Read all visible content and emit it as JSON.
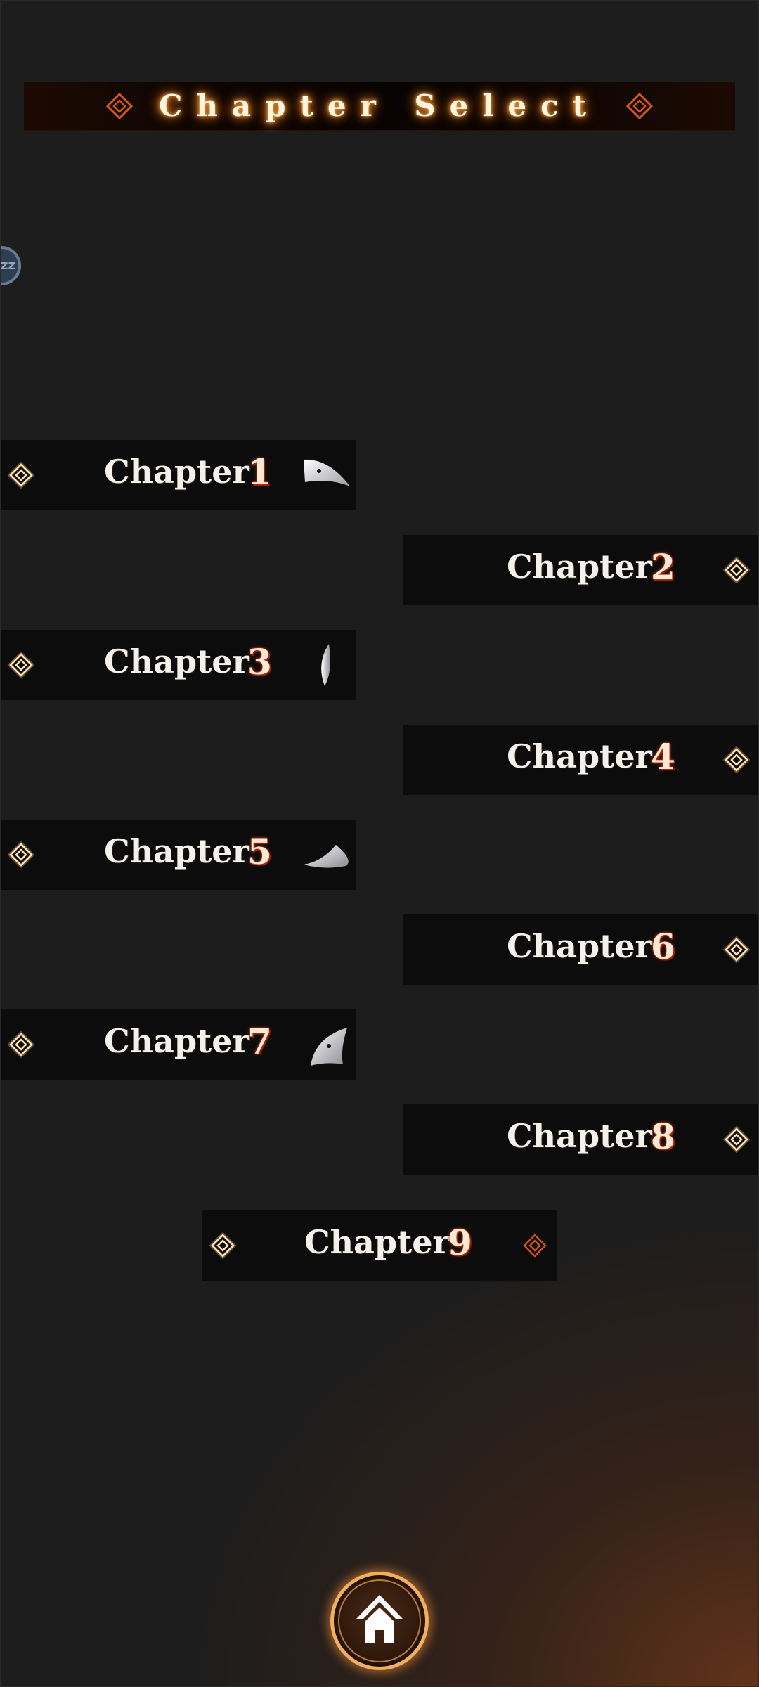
{
  "header": {
    "title": "Chapter Select"
  },
  "side_bubble": {
    "label": "zz"
  },
  "chapters": [
    {
      "word": "Chapter",
      "number": "1",
      "side": "left",
      "piece": "fragment-1"
    },
    {
      "word": "Chapter",
      "number": "2",
      "side": "right",
      "piece": null
    },
    {
      "word": "Chapter",
      "number": "3",
      "side": "left",
      "piece": "fragment-3"
    },
    {
      "word": "Chapter",
      "number": "4",
      "side": "right",
      "piece": null
    },
    {
      "word": "Chapter",
      "number": "5",
      "side": "left",
      "piece": "fragment-5"
    },
    {
      "word": "Chapter",
      "number": "6",
      "side": "right",
      "piece": null
    },
    {
      "word": "Chapter",
      "number": "7",
      "side": "left",
      "piece": "fragment-7"
    },
    {
      "word": "Chapter",
      "number": "8",
      "side": "right",
      "piece": null
    },
    {
      "word": "Chapter",
      "number": "9",
      "side": "center",
      "piece": null
    }
  ],
  "home_button": {
    "icon": "home-icon"
  },
  "colors": {
    "background": "#1d1d1d",
    "accent_orange": "#e0703a",
    "glow_diamond": "#f6d6a0",
    "number_red": "#c23a10",
    "home_ring": "#f0b060"
  }
}
